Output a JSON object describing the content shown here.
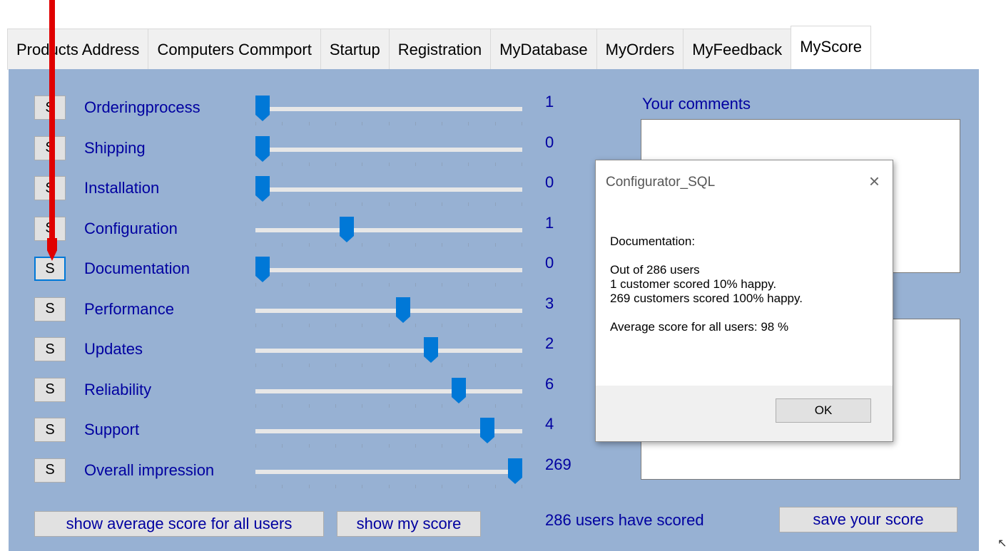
{
  "tabs": [
    {
      "label": "Products Address",
      "active": false
    },
    {
      "label": "Computers Commport",
      "active": false
    },
    {
      "label": "Startup",
      "active": false
    },
    {
      "label": "Registration",
      "active": false
    },
    {
      "label": "MyDatabase",
      "active": false
    },
    {
      "label": "MyOrders",
      "active": false
    },
    {
      "label": "MyFeedback",
      "active": false
    },
    {
      "label": "MyScore",
      "active": true
    }
  ],
  "score_rows": [
    {
      "button": "S",
      "label": "Orderingprocess",
      "value": "1",
      "slider_position": 0
    },
    {
      "button": "S",
      "label": "Shipping",
      "value": "0",
      "slider_position": 0
    },
    {
      "button": "S",
      "label": "Installation",
      "value": "0",
      "slider_position": 0
    },
    {
      "button": "S",
      "label": "Configuration",
      "value": "1",
      "slider_position": 0.333
    },
    {
      "button": "S",
      "label": "Documentation",
      "value": "0",
      "slider_position": 0,
      "focused": true
    },
    {
      "button": "S",
      "label": "Performance",
      "value": "3",
      "slider_position": 0.556
    },
    {
      "button": "S",
      "label": "Updates",
      "value": "2",
      "slider_position": 0.667
    },
    {
      "button": "S",
      "label": "Reliability",
      "value": "6",
      "slider_position": 0.778
    },
    {
      "button": "S",
      "label": "Support",
      "value": "4",
      "slider_position": 0.889
    },
    {
      "button": "S",
      "label": "Overall impression",
      "value": "269",
      "slider_position": 1
    }
  ],
  "comments_label": "Your comments",
  "show_average_button": "show average score for all users",
  "show_my_score_button": "show my score",
  "users_scored_text": "286 users have scored",
  "save_button": "save your score",
  "dialog": {
    "title": "Configurator_SQL",
    "close_glyph": "×",
    "lines": [
      "Documentation:",
      "",
      "Out of 286 users",
      "1 customer scored 10% happy.",
      "269 customers scored 100% happy.",
      "",
      "Average score for all users: 98 %"
    ],
    "ok_label": "OK"
  },
  "colors": {
    "panel": "#97b1d3",
    "label_text": "#0000a0",
    "thumb": "#0078d7",
    "annotation_arrow": "#e00000"
  },
  "icons": {
    "annotation": "red-arrow-icon",
    "cursor": "resize-cursor-icon"
  }
}
